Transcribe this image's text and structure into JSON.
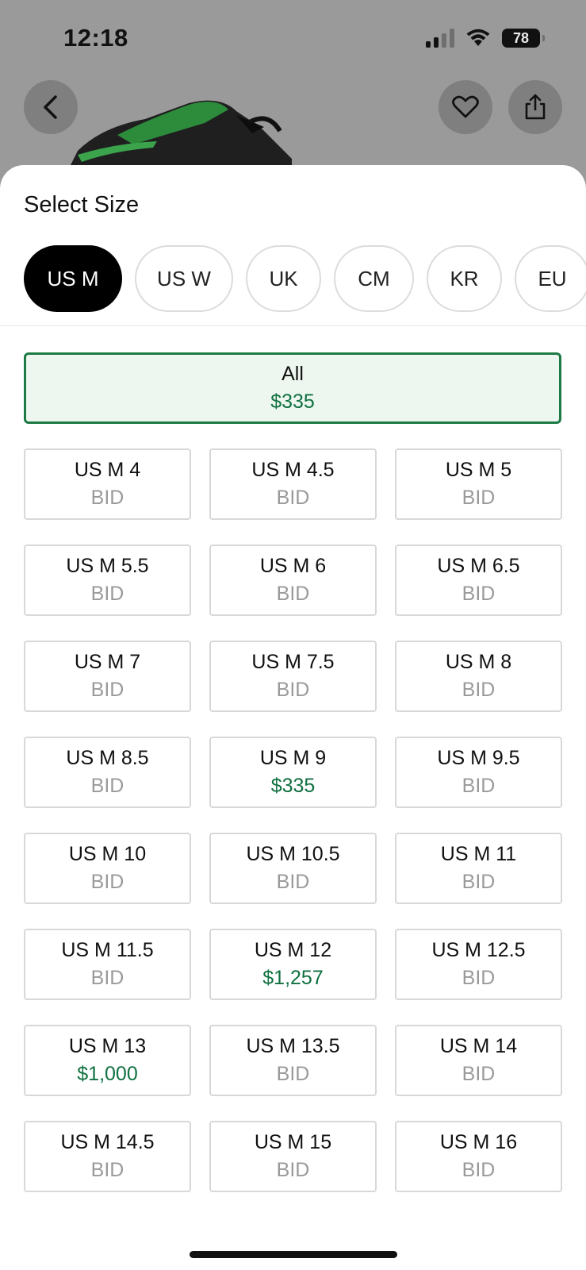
{
  "status_bar": {
    "time": "12:18",
    "battery": "78"
  },
  "sheet": {
    "title": "Select Size",
    "tabs": [
      {
        "label": "US M",
        "active": true
      },
      {
        "label": "US W",
        "active": false
      },
      {
        "label": "UK",
        "active": false
      },
      {
        "label": "CM",
        "active": false
      },
      {
        "label": "KR",
        "active": false
      },
      {
        "label": "EU",
        "active": false
      }
    ],
    "all_option": {
      "label": "All",
      "price": "$335"
    },
    "sizes": [
      {
        "size": "US M 4",
        "price": "BID"
      },
      {
        "size": "US M 4.5",
        "price": "BID"
      },
      {
        "size": "US M 5",
        "price": "BID"
      },
      {
        "size": "US M 5.5",
        "price": "BID"
      },
      {
        "size": "US M 6",
        "price": "BID"
      },
      {
        "size": "US M 6.5",
        "price": "BID"
      },
      {
        "size": "US M 7",
        "price": "BID"
      },
      {
        "size": "US M 7.5",
        "price": "BID"
      },
      {
        "size": "US M 8",
        "price": "BID"
      },
      {
        "size": "US M 8.5",
        "price": "BID"
      },
      {
        "size": "US M 9",
        "price": "$335"
      },
      {
        "size": "US M 9.5",
        "price": "BID"
      },
      {
        "size": "US M 10",
        "price": "BID"
      },
      {
        "size": "US M 10.5",
        "price": "BID"
      },
      {
        "size": "US M 11",
        "price": "BID"
      },
      {
        "size": "US M 11.5",
        "price": "BID"
      },
      {
        "size": "US M 12",
        "price": "$1,257"
      },
      {
        "size": "US M 12.5",
        "price": "BID"
      },
      {
        "size": "US M 13",
        "price": "$1,000"
      },
      {
        "size": "US M 13.5",
        "price": "BID"
      },
      {
        "size": "US M 14",
        "price": "BID"
      },
      {
        "size": "US M 14.5",
        "price": "BID"
      },
      {
        "size": "US M 15",
        "price": "BID"
      },
      {
        "size": "US M 16",
        "price": "BID"
      }
    ]
  },
  "colors": {
    "accent_green": "#0f7040",
    "selected_bg": "#edf7f0",
    "muted": "#9a9a9a"
  }
}
